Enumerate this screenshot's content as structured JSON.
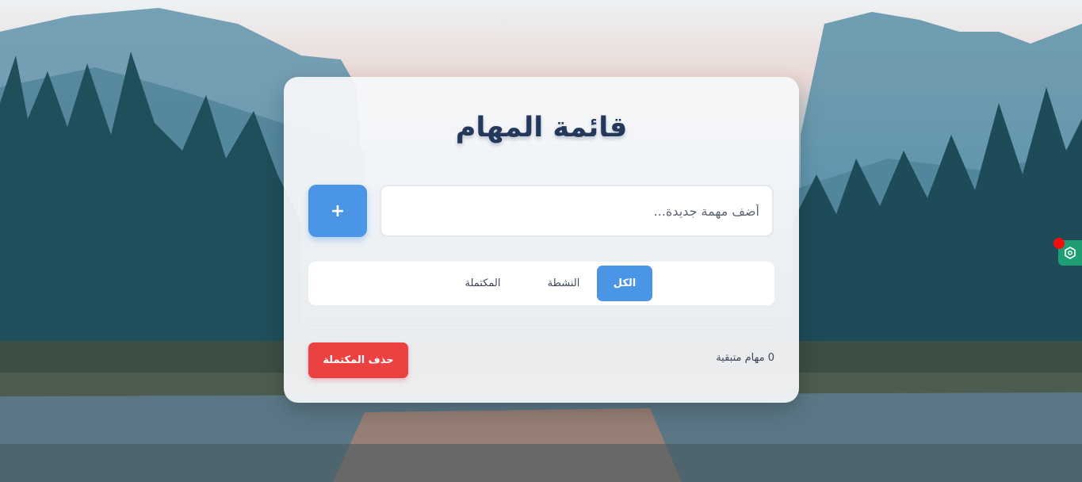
{
  "todo": {
    "title": "قائمة المهام",
    "input_placeholder": "أضف مهمة جديدة...",
    "add_button_label": "+",
    "filters": {
      "all": "الكل",
      "active": "النشطة",
      "completed": "المكتملة"
    },
    "remaining_text": "0 مهام متبقية",
    "clear_completed_label": "حذف المكتملة"
  },
  "colors": {
    "accent": "#4a95e6",
    "danger": "#ec4141",
    "title": "#23385a",
    "extension_badge": "#1f9d73"
  },
  "icons": {
    "extension": "hexagon-extension-icon",
    "notification": "red-notification-dot"
  }
}
